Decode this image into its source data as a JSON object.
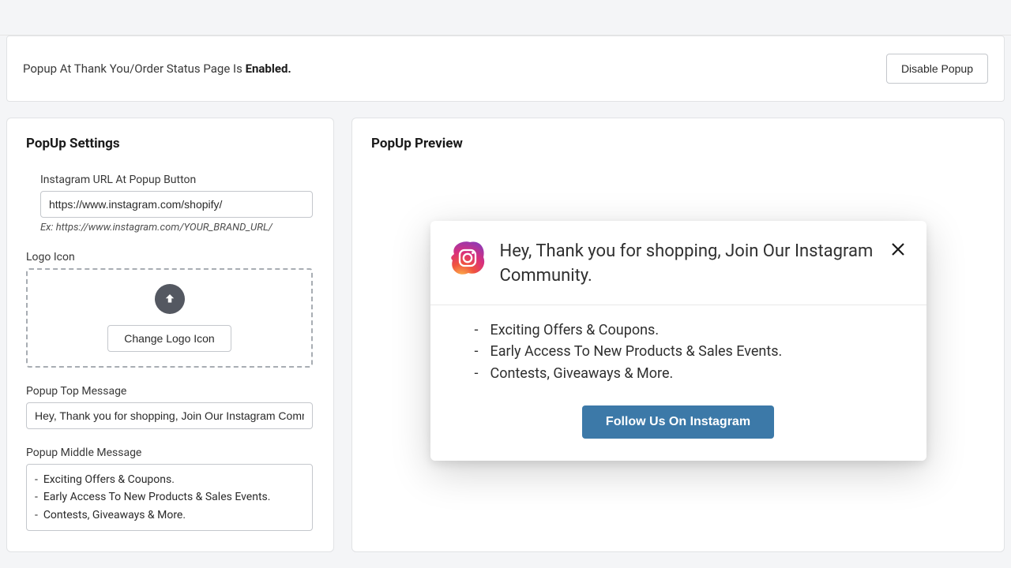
{
  "status_bar": {
    "text_prefix": "Popup At Thank You/Order Status Page Is ",
    "status_word": "Enabled.",
    "disable_button": "Disable Popup"
  },
  "settings": {
    "heading": "PopUp Settings",
    "url_label": "Instagram URL At Popup Button",
    "url_value": "https://www.instagram.com/shopify/",
    "url_hint": "Ex: https://www.instagram.com/YOUR_BRAND_URL/",
    "logo_label": "Logo Icon",
    "change_logo_button": "Change Logo Icon",
    "top_msg_label": "Popup Top Message",
    "top_msg_value": "Hey, Thank you for shopping, Join Our Instagram Community.",
    "mid_msg_label": "Popup Middle Message",
    "mid_msg_value": "-  Exciting Offers & Coupons.\n-  Early Access To New Products & Sales Events.\n-  Contests, Giveaways & More."
  },
  "preview": {
    "heading": "PopUp Preview",
    "popup_title": "Hey, Thank you for shopping, Join Our Instagram Community.",
    "bullets": [
      "Exciting Offers & Coupons.",
      "Early Access To New Products & Sales Events.",
      "Contests, Giveaways & More."
    ],
    "follow_button": "Follow Us On Instagram"
  }
}
